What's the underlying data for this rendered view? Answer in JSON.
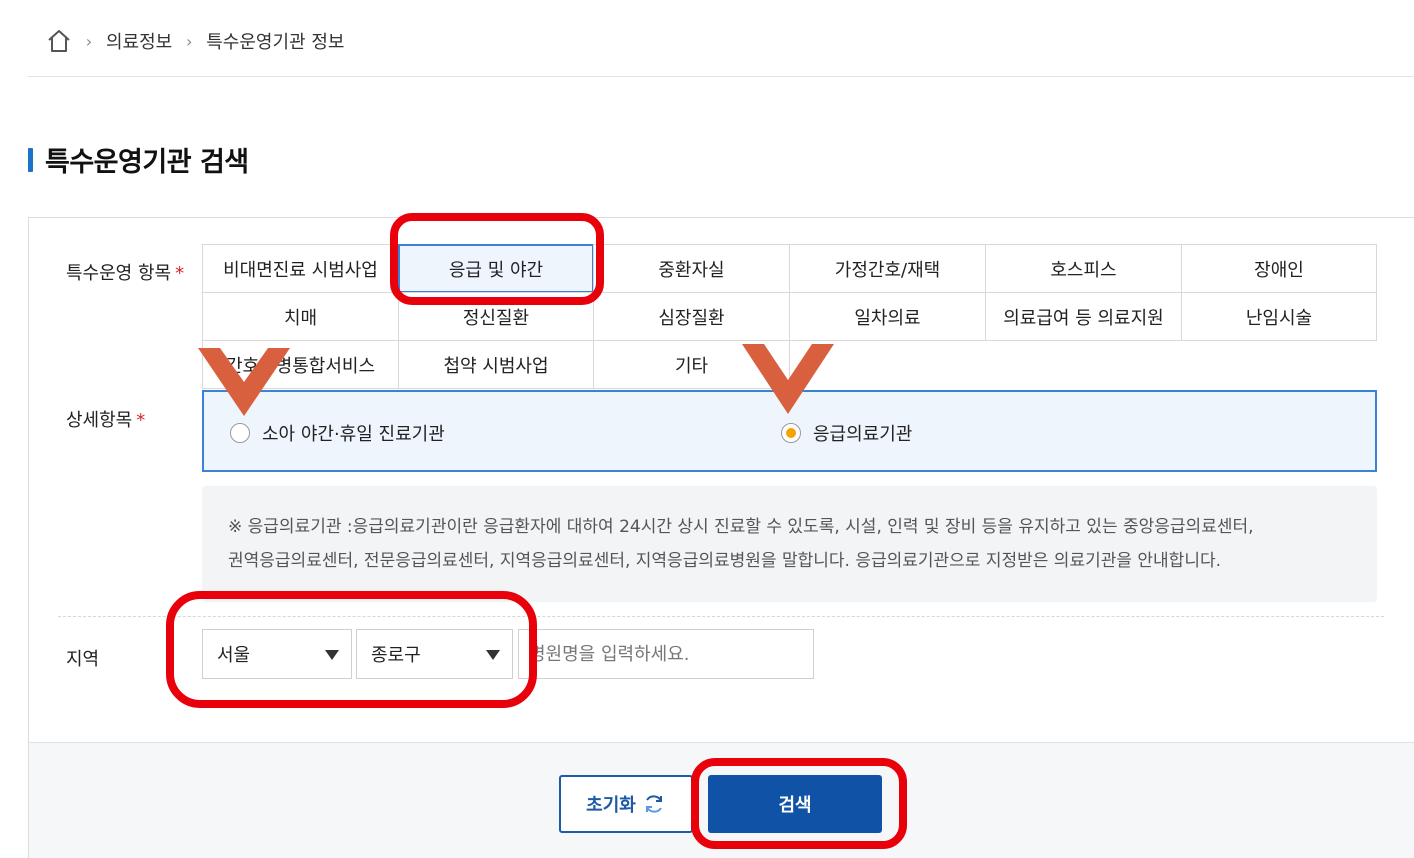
{
  "breadcrumb": {
    "items": [
      "의료정보",
      "특수운영기관 정보"
    ]
  },
  "section": {
    "title": "특수운영기관 검색"
  },
  "category": {
    "label": "특수운영 항목",
    "required_mark": "*",
    "selected": "응급 및 야간",
    "items": [
      "비대면진료 시범사업",
      "응급 및 야간",
      "중환자실",
      "가정간호/재택",
      "호스피스",
      "장애인",
      "치매",
      "정신질환",
      "심장질환",
      "일차의료",
      "의료급여 등 의료지원",
      "난임시술",
      "간호간병통합서비스",
      "첩약 시범사업",
      "기타"
    ]
  },
  "detail": {
    "label": "상세항목",
    "required_mark": "*",
    "options": [
      {
        "label": "소아 야간·휴일 진료기관",
        "checked": false
      },
      {
        "label": "응급의료기관",
        "checked": true
      }
    ]
  },
  "notice": {
    "line1": "※ 응급의료기관 :응급의료기관이란 응급환자에 대하여 24시간 상시 진료할 수 있도록, 시설, 인력 및 장비 등을 유지하고 있는 중앙응급의료센터,",
    "line2": "권역응급의료센터, 전문응급의료센터, 지역응급의료센터, 지역응급의료병원을 말합니다. 응급의료기관으로 지정받은 의료기관을 안내합니다."
  },
  "region": {
    "label": "지역",
    "city": "서울",
    "district": "종로구",
    "search_placeholder": "병원명을 입력하세요."
  },
  "buttons": {
    "reset": "초기화",
    "search": "검색"
  },
  "colors": {
    "accent": "#1a73c8",
    "primary_button": "#0f52a6",
    "highlight": "#e8000b",
    "annotation_chevron": "#d9603f",
    "radio_on": "#f5a300"
  }
}
